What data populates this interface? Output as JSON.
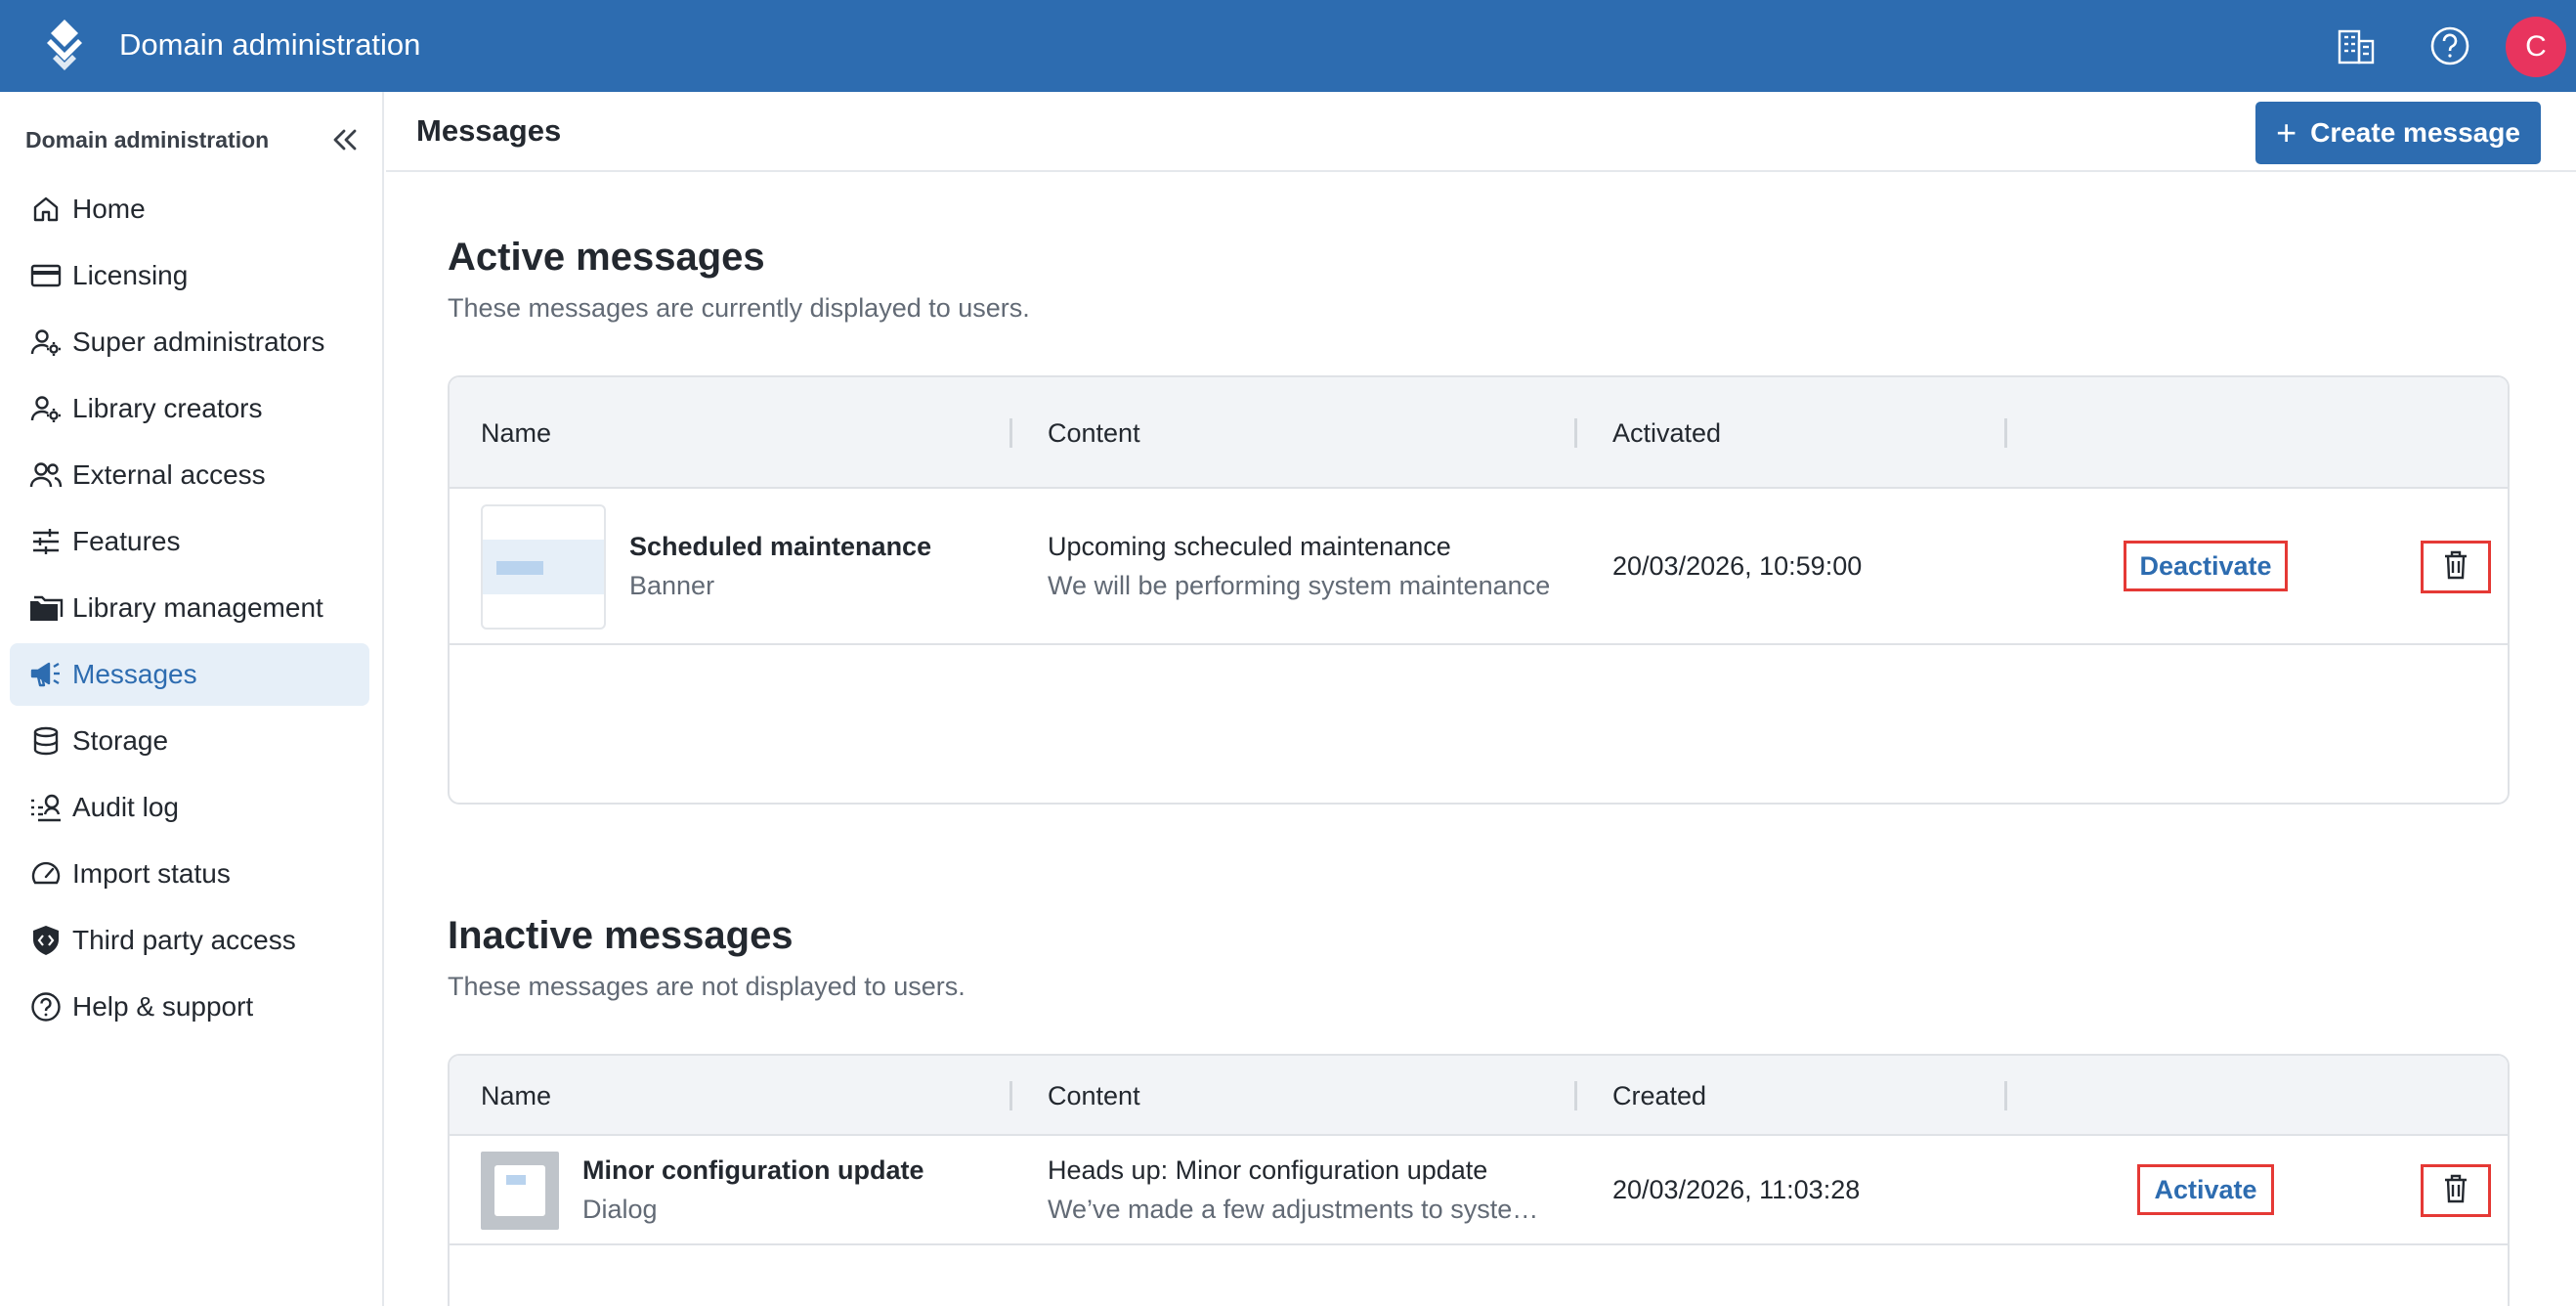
{
  "header": {
    "app_title": "Domain administration",
    "avatar_initial": "C",
    "icons": [
      "layers-logo-icon",
      "building-icon",
      "help-circle-icon"
    ]
  },
  "sidebar": {
    "heading": "Domain administration",
    "items": [
      {
        "label": "Home",
        "icon": "home-icon"
      },
      {
        "label": "Licensing",
        "icon": "credit-card-icon"
      },
      {
        "label": "Super administrators",
        "icon": "user-gear-icon"
      },
      {
        "label": "Library creators",
        "icon": "user-gear-icon"
      },
      {
        "label": "External access",
        "icon": "users-icon"
      },
      {
        "label": "Features",
        "icon": "sliders-icon"
      },
      {
        "label": "Library management",
        "icon": "folders-icon"
      },
      {
        "label": "Messages",
        "icon": "megaphone-icon",
        "active": true
      },
      {
        "label": "Storage",
        "icon": "database-icon"
      },
      {
        "label": "Audit log",
        "icon": "list-search-icon"
      },
      {
        "label": "Import status",
        "icon": "gauge-icon"
      },
      {
        "label": "Third party access",
        "icon": "shield-code-icon"
      },
      {
        "label": "Help & support",
        "icon": "help-circle-icon"
      }
    ]
  },
  "main": {
    "title": "Messages",
    "create_button": "Create message",
    "active": {
      "title": "Active messages",
      "subtitle": "These messages are currently displayed to users.",
      "columns": [
        "Name",
        "Content",
        "Activated"
      ],
      "rows": [
        {
          "name": "Scheduled maintenance",
          "type": "Banner",
          "content_title": "Upcoming scheculed maintenance",
          "content_desc": "We will be performing system maintenance",
          "date": "20/03/2026, 10:59:00",
          "action": "Deactivate"
        }
      ]
    },
    "inactive": {
      "title": "Inactive messages",
      "subtitle": "These messages are not displayed to users.",
      "columns": [
        "Name",
        "Content",
        "Created"
      ],
      "rows": [
        {
          "name": "Minor configuration update",
          "type": "Dialog",
          "content_title": "Heads up: Minor configuration update",
          "content_desc": "We’ve made a few adjustments to system settings",
          "date": "20/03/2026, 11:03:28",
          "action": "Activate"
        }
      ]
    }
  },
  "colors": {
    "brand": "#2d6cb0",
    "avatar": "#e8345e",
    "highlight_border": "#e53935",
    "active_nav_bg": "#e6eff8"
  }
}
